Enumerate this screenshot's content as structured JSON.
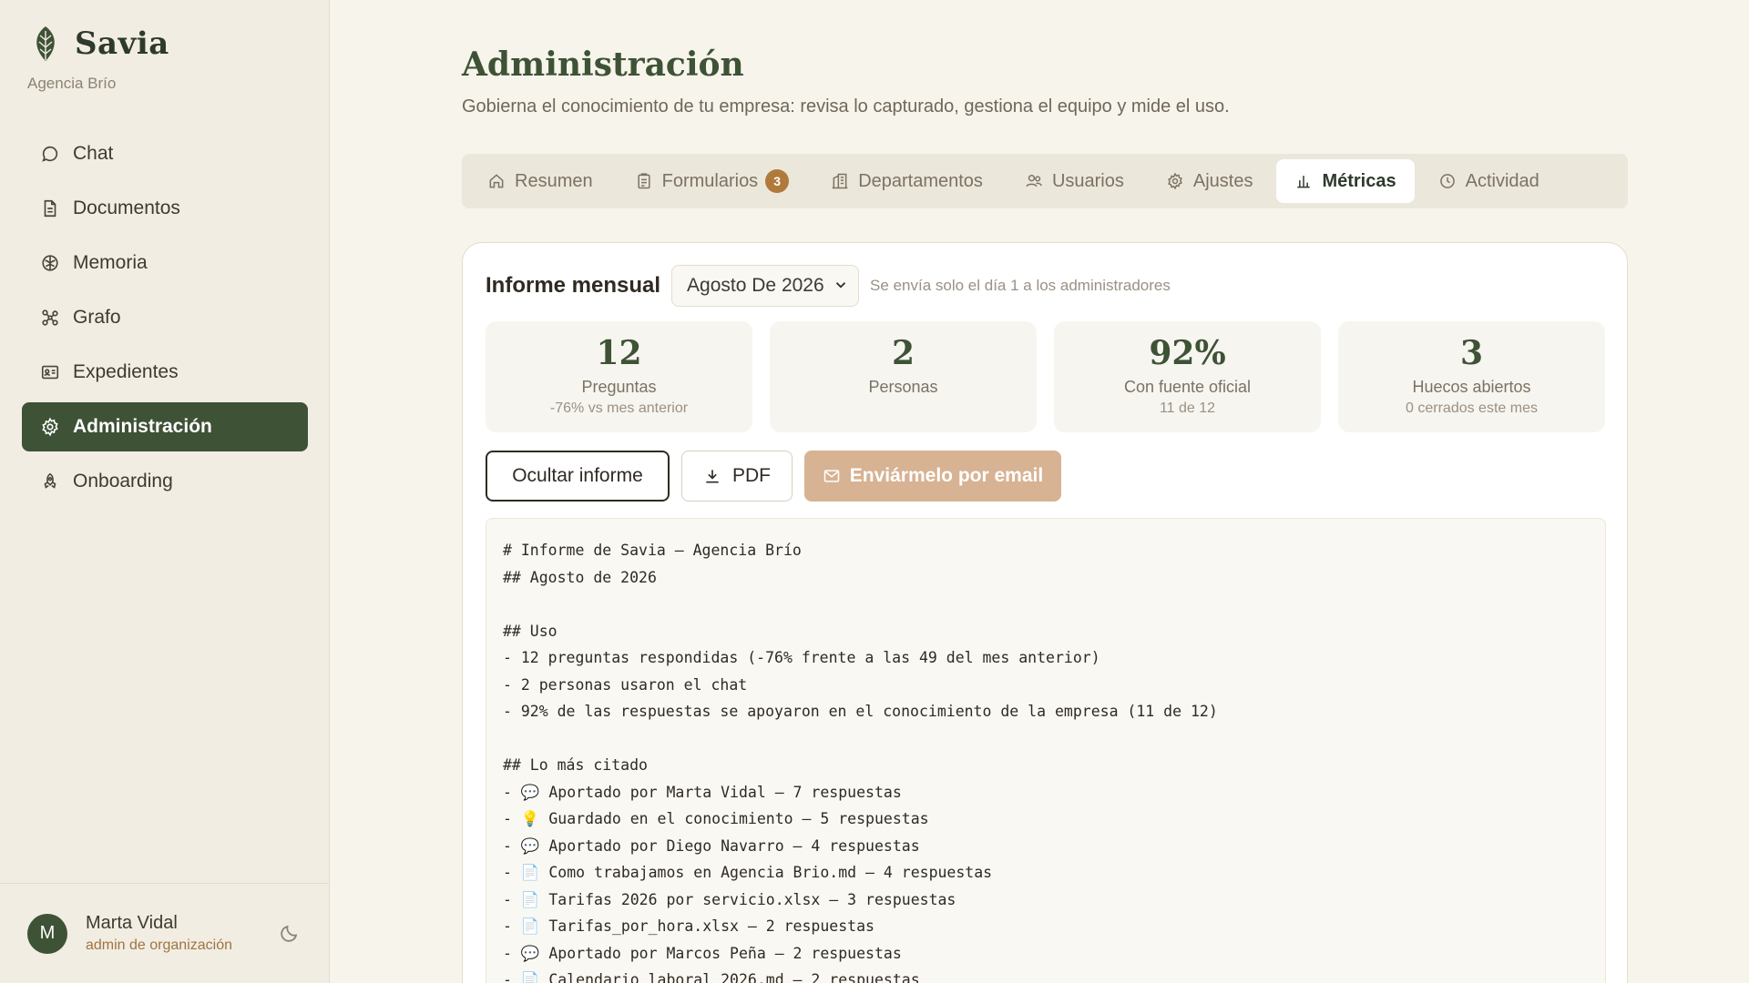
{
  "brand": {
    "name": "Savia",
    "org": "Agencia Brío"
  },
  "nav": [
    {
      "label": "Chat",
      "icon": "chat-icon"
    },
    {
      "label": "Documentos",
      "icon": "document-icon"
    },
    {
      "label": "Memoria",
      "icon": "brain-icon"
    },
    {
      "label": "Grafo",
      "icon": "graph-icon"
    },
    {
      "label": "Expedientes",
      "icon": "id-card-icon"
    },
    {
      "label": "Administración",
      "icon": "gear-icon",
      "active": true
    },
    {
      "label": "Onboarding",
      "icon": "rocket-icon"
    }
  ],
  "user": {
    "initial": "M",
    "name": "Marta Vidal",
    "role": "admin de organización"
  },
  "page": {
    "title": "Administración",
    "subtitle": "Gobierna el conocimiento de tu empresa: revisa lo capturado, gestiona el equipo y mide el uso."
  },
  "tabs": [
    {
      "label": "Resumen",
      "icon": "home-icon"
    },
    {
      "label": "Formularios",
      "icon": "clipboard-icon",
      "badge": "3"
    },
    {
      "label": "Departamentos",
      "icon": "building-icon"
    },
    {
      "label": "Usuarios",
      "icon": "users-icon"
    },
    {
      "label": "Ajustes",
      "icon": "gear-icon"
    },
    {
      "label": "Métricas",
      "icon": "bar-chart-icon",
      "active": true
    },
    {
      "label": "Actividad",
      "icon": "clock-icon"
    }
  ],
  "report": {
    "title": "Informe mensual",
    "month": "Agosto De 2026",
    "note": "Se envía solo el día 1 a los administradores",
    "stats": [
      {
        "value": "12",
        "label": "Preguntas",
        "sub": "-76% vs mes anterior"
      },
      {
        "value": "2",
        "label": "Personas",
        "sub": ""
      },
      {
        "value": "92%",
        "label": "Con fuente oficial",
        "sub": "11 de 12"
      },
      {
        "value": "3",
        "label": "Huecos abiertos",
        "sub": "0 cerrados este mes"
      }
    ],
    "actions": {
      "hide": "Ocultar informe",
      "pdf": "PDF",
      "email": "Enviármelo por email"
    },
    "lines": [
      "# Informe de Savia — Agencia Brío",
      "## Agosto de 2026",
      "",
      "## Uso",
      "- 12 preguntas respondidas (-76% frente a las 49 del mes anterior)",
      "- 2 personas usaron el chat",
      "- 92% de las respuestas se apoyaron en el conocimiento de la empresa (11 de 12)",
      "",
      "## Lo más citado",
      "- 💬 Aportado por Marta Vidal — 7 respuestas",
      "- 💡 Guardado en el conocimiento — 5 respuestas",
      "- 💬 Aportado por Diego Navarro — 4 respuestas",
      "- 📄 Como trabajamos en Agencia Brio.md — 4 respuestas",
      "- 📄 Tarifas 2026 por servicio.xlsx — 3 respuestas",
      "- 📄 Tarifas_por_hora.xlsx — 2 respuestas",
      "- 💬 Aportado por Marcos Peña — 2 respuestas",
      "- 📄 Calendario laboral 2026.md — 2 respuestas"
    ]
  },
  "colors": {
    "accent": "#3e5236",
    "badge": "#b07a3c",
    "email_button": "#d7b293"
  }
}
